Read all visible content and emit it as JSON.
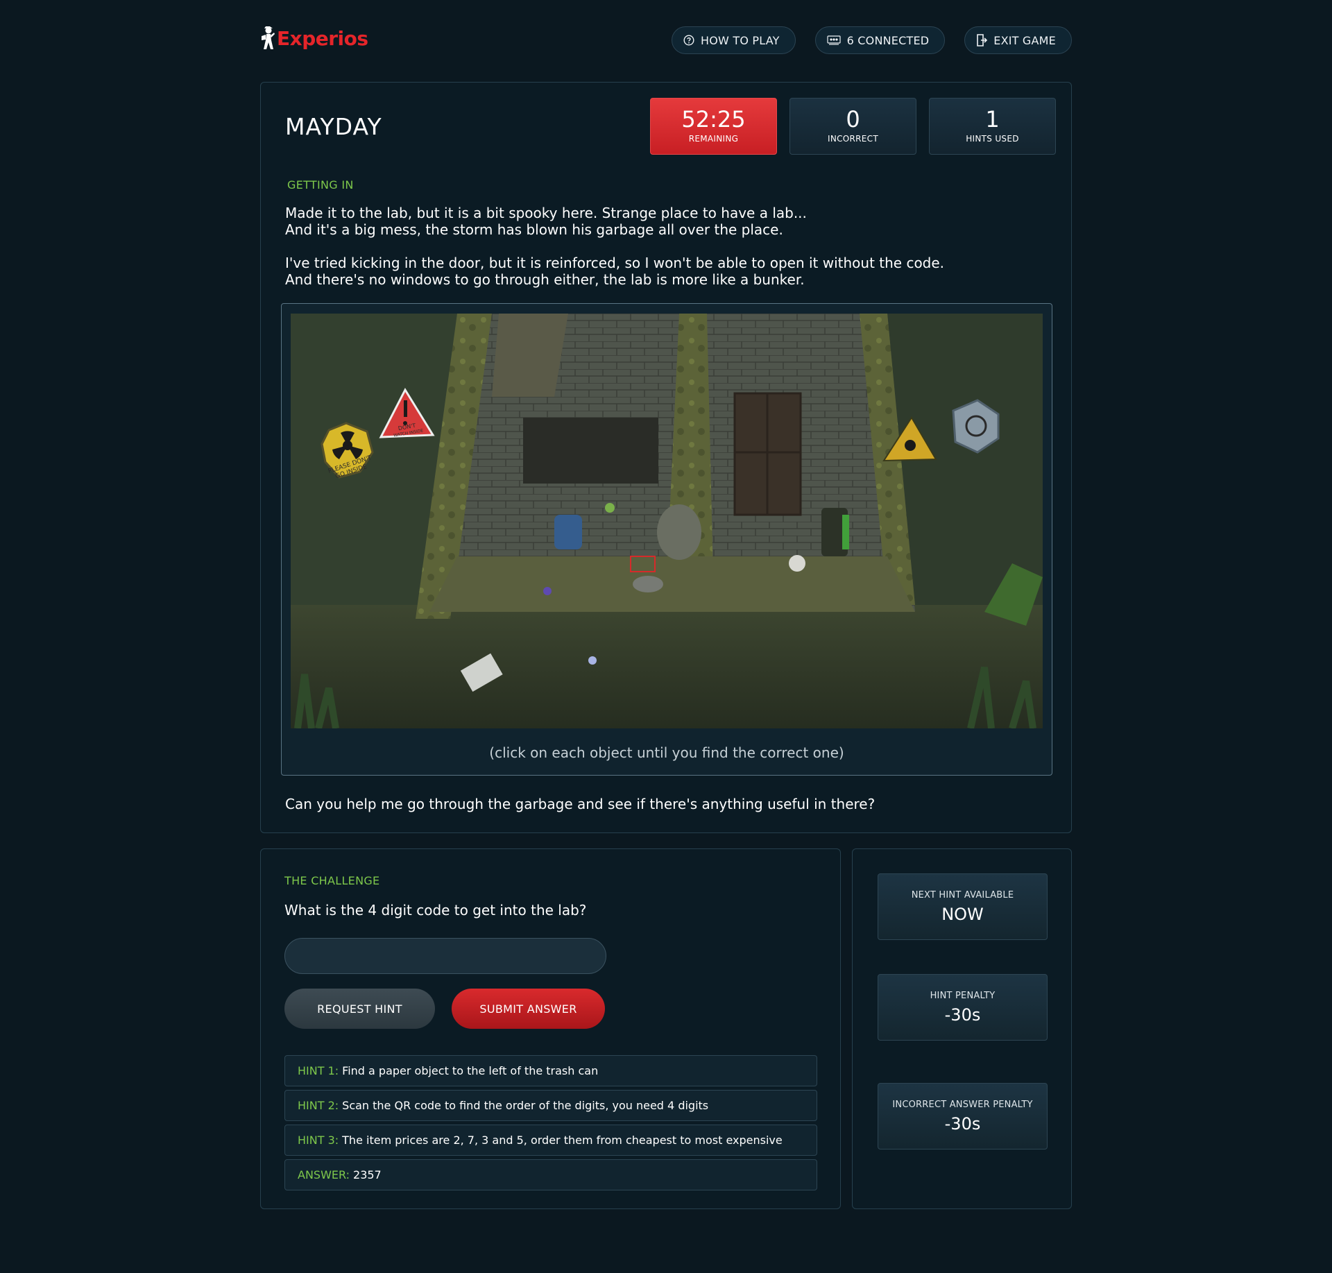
{
  "header": {
    "logo_text": "Experios",
    "nav": [
      {
        "label": "HOW TO PLAY",
        "icon": "help-circle-icon"
      },
      {
        "label": "6 CONNECTED",
        "icon": "users-icon"
      },
      {
        "label": "EXIT GAME",
        "icon": "exit-door-icon"
      }
    ]
  },
  "game": {
    "title": "MAYDAY",
    "stats": [
      {
        "value": "52:25",
        "label": "REMAINING"
      },
      {
        "value": "0",
        "label": "INCORRECT"
      },
      {
        "value": "1",
        "label": "HINTS USED"
      }
    ],
    "stage_label": "GETTING IN",
    "story": [
      "Made it to the lab, but it is a bit spooky here. Strange place to have a lab...",
      "And it's a big mess, the storm has blown his garbage all over the place.",
      "I've tried kicking in the door, but it is reinforced, so I won't be able to open it without the code.",
      "And there's no windows to go through either, the lab is more like a bunker."
    ],
    "scene_signs": {
      "radiation": [
        "PLEASE DON'T",
        "GO INSIDE"
      ],
      "warning": [
        "DON'T",
        "WATCH INSIDE"
      ]
    },
    "image_caption": "(click on each object until you find the correct one)",
    "question_text": "Can you help me go through the garbage and see if there's anything useful in there?"
  },
  "challenge": {
    "label": "THE CHALLENGE",
    "question": "What is the 4 digit code to get into the lab?",
    "input_value": "",
    "request_hint_label": "REQUEST HINT",
    "submit_label": "SUBMIT ANSWER",
    "hints": [
      {
        "key": "HINT 1:",
        "text": "Find a paper object to the left of the trash can"
      },
      {
        "key": "HINT 2:",
        "text": "Scan the QR code to find the order of the digits, you need 4 digits"
      },
      {
        "key": "HINT 3:",
        "text": "The item prices are 2, 7, 3 and 5, order them from cheapest to most expensive"
      },
      {
        "key": "ANSWER:",
        "text": "2357"
      }
    ]
  },
  "side": {
    "items": [
      {
        "label": "NEXT HINT AVAILABLE",
        "value": "NOW"
      },
      {
        "label": "HINT PENALTY",
        "value": "-30s"
      },
      {
        "label": "INCORRECT ANSWER PENALTY",
        "value": "-30s"
      }
    ]
  },
  "colors": {
    "background": "#0b1820",
    "accent_red": "#e5252a",
    "accent_green": "#7ec84b",
    "panel_border": "#26404e"
  }
}
